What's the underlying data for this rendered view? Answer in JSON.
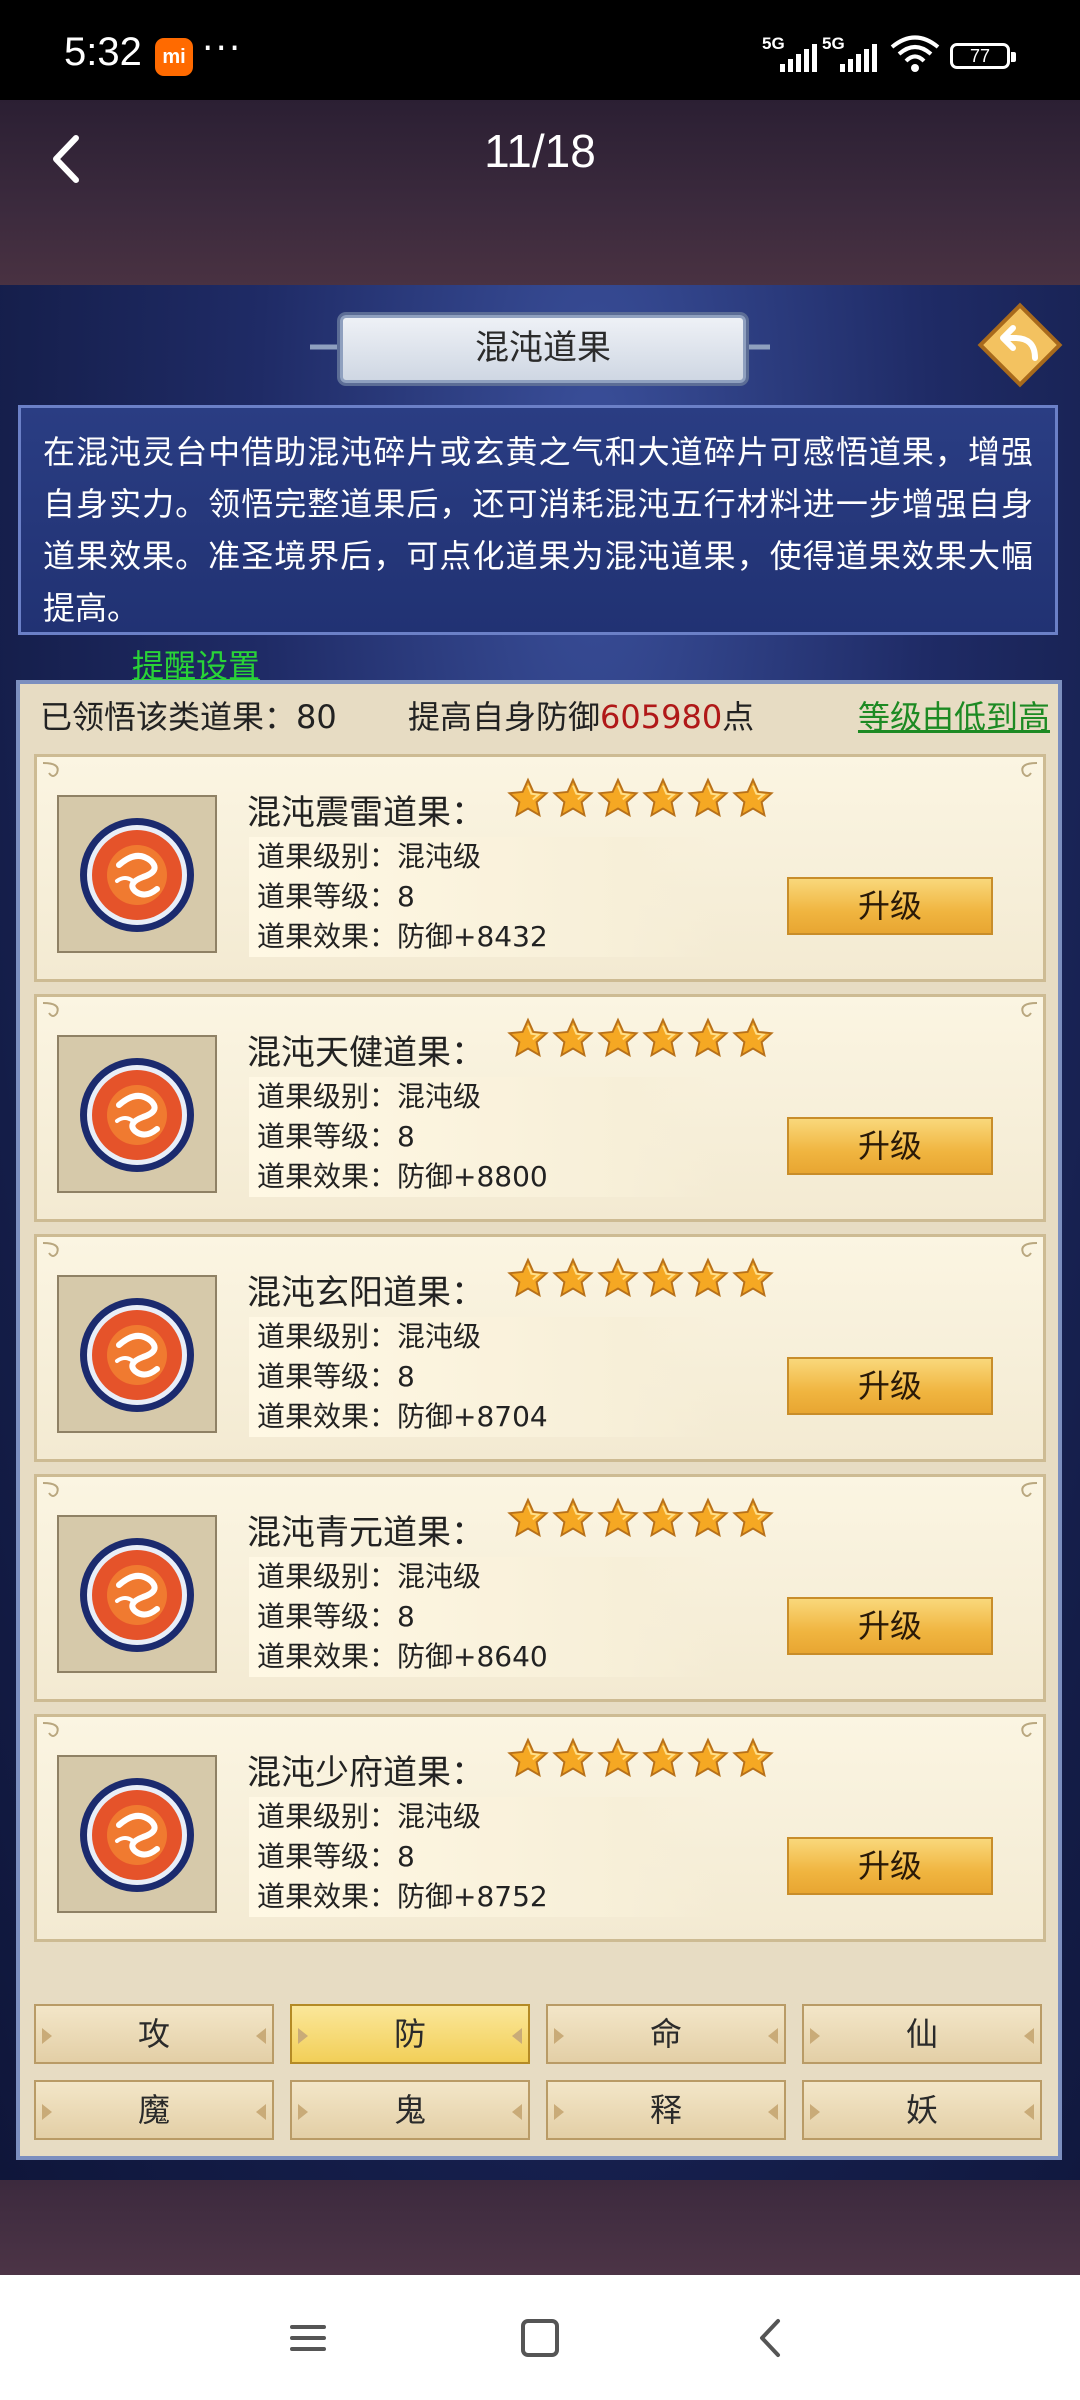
{
  "status_bar": {
    "time": "5:32",
    "app_badge": "mi",
    "more": "···",
    "network_1": "5G",
    "network_2": "5G",
    "battery": "77"
  },
  "header": {
    "page_counter": "11/18"
  },
  "game": {
    "title": "混沌道果",
    "description": "在混沌灵台中借助混沌碎片或玄黄之气和大道碎片可感悟道果，增强自身实力。领悟完整道果后，还可消耗混沌五行材料进一步增强自身道果效果。准圣境界后，可点化道果为混沌道果，使得道果效果大幅提高。",
    "reminder_link": "提醒设置",
    "stats": {
      "learned_label": "已领悟该类道果：80",
      "boost_prefix": "提高自身防御",
      "boost_value": "605980",
      "boost_suffix": "点"
    },
    "sort_label": "等级由低到高",
    "cards": [
      {
        "name": "混沌震雷道果：",
        "stars": 6,
        "grade": "道果级别：混沌级",
        "level": "道果等级：8",
        "effect": "道果效果：防御+8432",
        "button": "升级"
      },
      {
        "name": "混沌天健道果：",
        "stars": 6,
        "grade": "道果级别：混沌级",
        "level": "道果等级：8",
        "effect": "道果效果：防御+8800",
        "button": "升级"
      },
      {
        "name": "混沌玄阳道果：",
        "stars": 6,
        "grade": "道果级别：混沌级",
        "level": "道果等级：8",
        "effect": "道果效果：防御+8704",
        "button": "升级"
      },
      {
        "name": "混沌青元道果：",
        "stars": 6,
        "grade": "道果级别：混沌级",
        "level": "道果等级：8",
        "effect": "道果效果：防御+8640",
        "button": "升级"
      },
      {
        "name": "混沌少府道果：",
        "stars": 6,
        "grade": "道果级别：混沌级",
        "level": "道果等级：8",
        "effect": "道果效果：防御+8752",
        "button": "升级"
      }
    ],
    "tabs": [
      {
        "label": "攻",
        "active": false
      },
      {
        "label": "防",
        "active": true
      },
      {
        "label": "命",
        "active": false
      },
      {
        "label": "仙",
        "active": false
      },
      {
        "label": "魔",
        "active": false
      },
      {
        "label": "鬼",
        "active": false
      },
      {
        "label": "释",
        "active": false
      },
      {
        "label": "妖",
        "active": false
      }
    ]
  },
  "icons": {
    "back": "chevron-left-icon",
    "return": "return-arrow-icon",
    "star": "star-icon",
    "fruit": "dragon-orb-icon",
    "nav_menu": "menu-icon",
    "nav_home": "home-square-icon",
    "nav_back": "back-chevron-icon"
  },
  "colors": {
    "highlight_value": "#b01818",
    "link_green": "#29d337",
    "button_gold": "#f0b540"
  }
}
